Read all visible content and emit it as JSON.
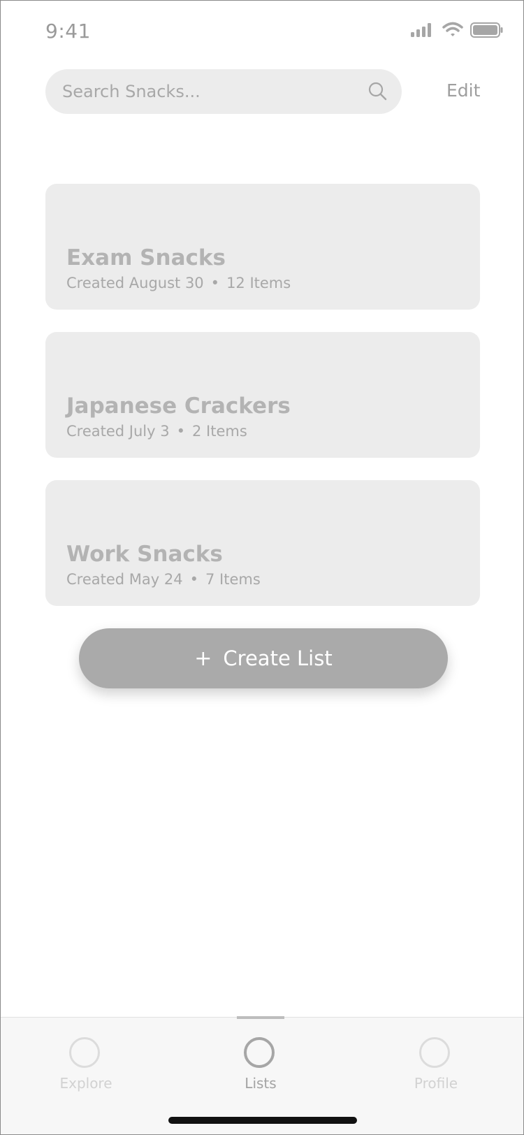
{
  "status_bar": {
    "time": "9:41",
    "icons": [
      "signal-icon",
      "wifi-icon",
      "battery-icon"
    ]
  },
  "search": {
    "placeholder": "Search Snacks...",
    "value": "",
    "icon": "search-icon"
  },
  "header": {
    "edit_label": "Edit"
  },
  "lists": [
    {
      "title": "Exam Snacks",
      "created": "Created August 30",
      "separator": "•",
      "items": "12 Items"
    },
    {
      "title": "Japanese Crackers",
      "created": "Created July 3",
      "separator": "•",
      "items": "2 Items"
    },
    {
      "title": "Work Snacks",
      "created": "Created May 24",
      "separator": "•",
      "items": "7 Items"
    }
  ],
  "create_button": {
    "icon": "+",
    "label": "Create List"
  },
  "tab_bar": {
    "tabs": [
      {
        "label": "Explore",
        "active": false
      },
      {
        "label": "Lists",
        "active": true
      },
      {
        "label": "Profile",
        "active": false
      }
    ]
  },
  "colors": {
    "card_bg": "#ececec",
    "button_bg": "#aaaaaa",
    "muted_text": "#a8a8a8"
  }
}
